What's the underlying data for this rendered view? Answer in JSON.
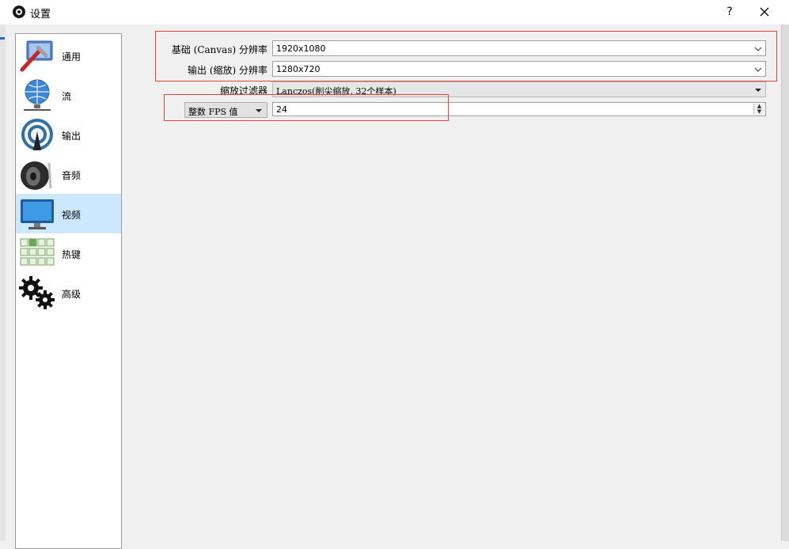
{
  "window": {
    "title": "设置",
    "help_label": "?",
    "close_label": "✕"
  },
  "sidebar": {
    "items": [
      {
        "label": "通用",
        "icon": "general-settings-icon"
      },
      {
        "label": "流",
        "icon": "stream-globe-icon"
      },
      {
        "label": "输出",
        "icon": "output-broadcast-icon"
      },
      {
        "label": "音频",
        "icon": "audio-speaker-icon"
      },
      {
        "label": "视频",
        "icon": "video-monitor-icon",
        "active": true
      },
      {
        "label": "热键",
        "icon": "hotkeys-keyboard-icon"
      },
      {
        "label": "高级",
        "icon": "advanced-gears-icon"
      }
    ]
  },
  "video": {
    "base_resolution": {
      "label": "基础 (Canvas) 分辨率",
      "value": "1920x1080"
    },
    "output_resolution": {
      "label": "输出 (缩放) 分辨率",
      "value": "1280x720"
    },
    "downscale_filter": {
      "label": "缩放过滤器",
      "value": "Lanczos(削尖缩放, 32个样本)"
    },
    "fps": {
      "type_value": "整数 FPS 值",
      "value": "24"
    }
  },
  "colors": {
    "active_item": "#cce8ff",
    "highlight_box": "#e0443a"
  }
}
